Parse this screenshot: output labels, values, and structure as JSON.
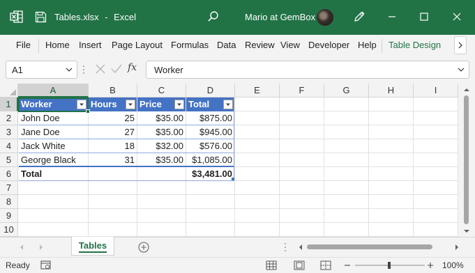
{
  "titlebar": {
    "filename": "Tables.xlsx",
    "separator": "-",
    "app": "Excel",
    "user": "Mario at GemBox",
    "bg_color": "#217346"
  },
  "ribbon": {
    "tabs": [
      "File",
      "Home",
      "Insert",
      "Page Layout",
      "Formulas",
      "Data",
      "Review",
      "View",
      "Developer",
      "Help",
      "Table Design"
    ],
    "active_tab": "Table Design"
  },
  "formula_bar": {
    "name_box": "A1",
    "formula": "Worker",
    "fx_label": "fx"
  },
  "grid": {
    "columns": [
      "A",
      "B",
      "C",
      "D",
      "E",
      "F",
      "G",
      "H",
      "I"
    ],
    "rows": [
      "1",
      "2",
      "3",
      "4",
      "5",
      "6",
      "7",
      "8",
      "9",
      "10"
    ],
    "selected_column": "A",
    "selected_row": "1"
  },
  "table": {
    "headers": [
      "Worker",
      "Hours",
      "Price",
      "Total"
    ],
    "rows": [
      [
        "John Doe",
        "25",
        "$35.00",
        "$875.00"
      ],
      [
        "Jane Doe",
        "27",
        "$35.00",
        "$945.00"
      ],
      [
        "Jack White",
        "18",
        "$32.00",
        "$576.00"
      ],
      [
        "George Black",
        "31",
        "$35.00",
        "$1,085.00"
      ]
    ],
    "total_label": "Total",
    "total_value": "$3,481.00",
    "header_color": "#4472c4"
  },
  "sheets": {
    "tabs": [
      "Tables"
    ],
    "active": "Tables"
  },
  "status": {
    "mode": "Ready",
    "zoom": "100%"
  }
}
